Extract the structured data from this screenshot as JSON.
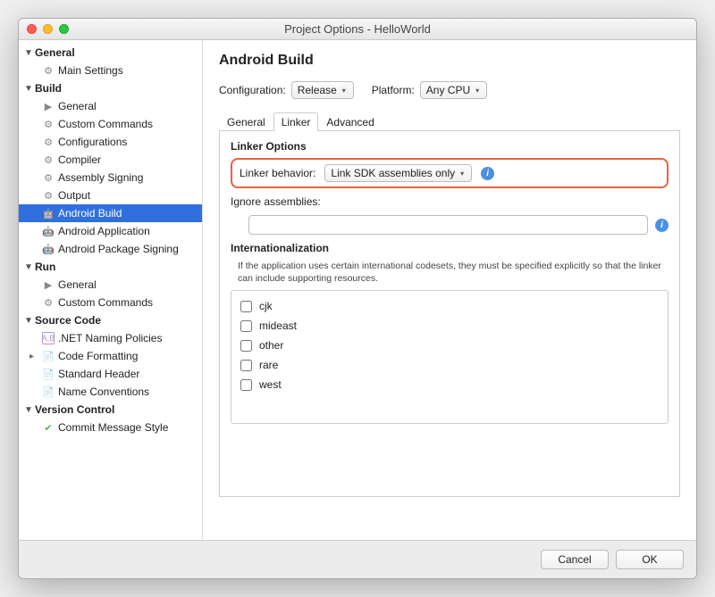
{
  "window": {
    "title": "Project Options - HelloWorld"
  },
  "sidebar": {
    "sections": [
      {
        "label": "General",
        "items": [
          {
            "icon": "gear",
            "label": "Main Settings"
          }
        ]
      },
      {
        "label": "Build",
        "items": [
          {
            "icon": "play",
            "label": "General"
          },
          {
            "icon": "gear",
            "label": "Custom Commands"
          },
          {
            "icon": "gear",
            "label": "Configurations"
          },
          {
            "icon": "gear",
            "label": "Compiler"
          },
          {
            "icon": "gear",
            "label": "Assembly Signing"
          },
          {
            "icon": "gear",
            "label": "Output"
          },
          {
            "icon": "droid",
            "label": "Android Build",
            "selected": true
          },
          {
            "icon": "droid",
            "label": "Android Application"
          },
          {
            "icon": "droid",
            "label": "Android Package Signing"
          }
        ]
      },
      {
        "label": "Run",
        "items": [
          {
            "icon": "play",
            "label": "General"
          },
          {
            "icon": "gear",
            "label": "Custom Commands"
          }
        ]
      },
      {
        "label": "Source Code",
        "items": [
          {
            "icon": "doc",
            "label": ".NET Naming Policies"
          },
          {
            "icon": "file",
            "label": "Code Formatting",
            "expandable": true
          },
          {
            "icon": "file",
            "label": "Standard Header"
          },
          {
            "icon": "file",
            "label": "Name Conventions"
          }
        ]
      },
      {
        "label": "Version Control",
        "items": [
          {
            "icon": "check",
            "label": "Commit Message Style"
          }
        ]
      }
    ]
  },
  "panel": {
    "title": "Android Build",
    "config_label": "Configuration:",
    "config_value": "Release",
    "platform_label": "Platform:",
    "platform_value": "Any CPU",
    "tabs": [
      "General",
      "Linker",
      "Advanced"
    ],
    "active_tab": 1,
    "linker": {
      "section_label": "Linker Options",
      "behavior_label": "Linker behavior:",
      "behavior_value": "Link SDK assemblies only",
      "ignore_label": "Ignore assemblies:",
      "ignore_value": "",
      "i18n_label": "Internationalization",
      "i18n_help": "If the application uses certain international codesets, they must be specified explicitly so that the linker can include supporting resources.",
      "i18n_options": [
        "cjk",
        "mideast",
        "other",
        "rare",
        "west"
      ]
    }
  },
  "footer": {
    "cancel": "Cancel",
    "ok": "OK"
  }
}
